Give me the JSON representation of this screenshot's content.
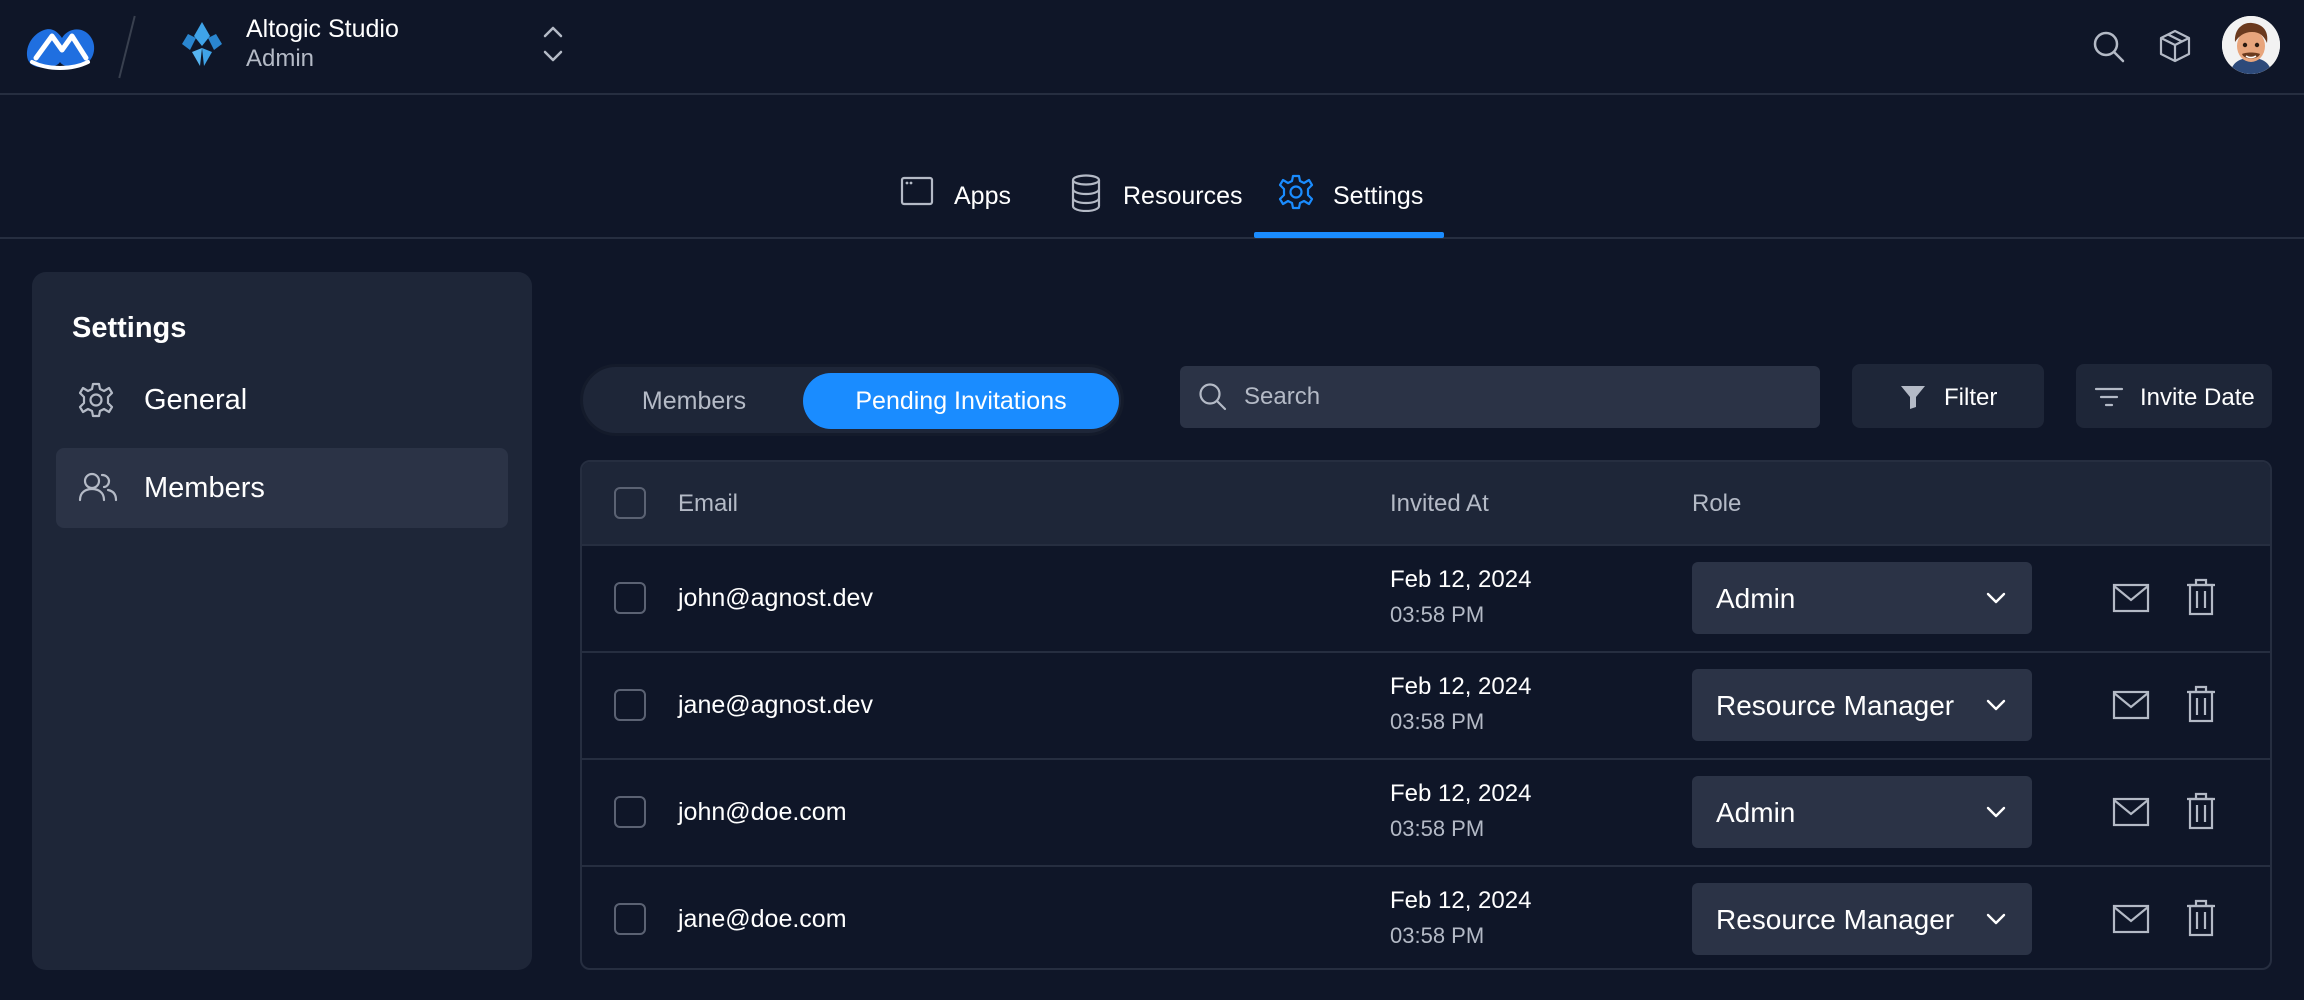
{
  "app": {
    "org_name": "Altogic Studio",
    "org_role": "Admin",
    "brand_color": "#1a8cff"
  },
  "nav": {
    "tabs": [
      {
        "label": "Apps",
        "icon": "app-window-icon"
      },
      {
        "label": "Resources",
        "icon": "database-icon"
      },
      {
        "label": "Settings",
        "icon": "gear-icon",
        "active": true
      }
    ]
  },
  "sidebar": {
    "title": "Settings",
    "items": [
      {
        "label": "General",
        "icon": "gear-icon"
      },
      {
        "label": "Members",
        "icon": "users-icon",
        "active": true
      }
    ]
  },
  "toolbar": {
    "toggle": {
      "members": "Members",
      "pending": "Pending Invitations",
      "selected": "Pending Invitations"
    },
    "search_placeholder": "Search",
    "filter_label": "Filter",
    "sort_label": "Invite Date"
  },
  "table": {
    "columns": {
      "email": "Email",
      "invited_at": "Invited At",
      "role": "Role"
    },
    "rows": [
      {
        "email": "john@agnost.dev",
        "date": "Feb 12, 2024",
        "time": "03:58 PM",
        "role": "Admin"
      },
      {
        "email": "jane@agnost.dev",
        "date": "Feb 12, 2024",
        "time": "03:58 PM",
        "role": "Resource Manager"
      },
      {
        "email": "john@doe.com",
        "date": "Feb 12, 2024",
        "time": "03:58 PM",
        "role": "Admin"
      },
      {
        "email": "jane@doe.com",
        "date": "Feb 12, 2024",
        "time": "03:58 PM",
        "role": "Resource Manager"
      }
    ]
  }
}
